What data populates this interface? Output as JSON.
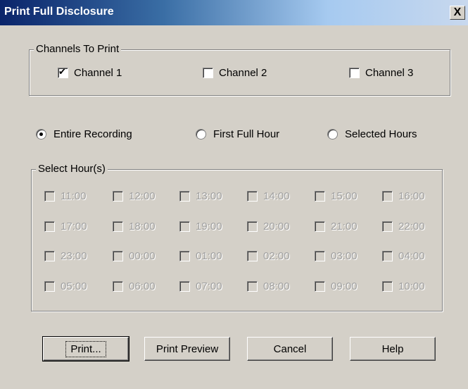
{
  "window": {
    "title": "Print Full Disclosure",
    "close_glyph": "X"
  },
  "channels": {
    "label": "Channels To Print",
    "items": [
      {
        "label": "Channel 1",
        "checked": true
      },
      {
        "label": "Channel 2",
        "checked": false
      },
      {
        "label": "Channel 3",
        "checked": false
      }
    ]
  },
  "range": {
    "options": [
      {
        "label": "Entire Recording",
        "selected": true
      },
      {
        "label": "First Full Hour",
        "selected": false
      },
      {
        "label": "Selected Hours",
        "selected": false
      }
    ]
  },
  "hours": {
    "label": "Select Hour(s)",
    "enabled": false,
    "items": [
      "11:00",
      "12:00",
      "13:00",
      "14:00",
      "15:00",
      "16:00",
      "17:00",
      "18:00",
      "19:00",
      "20:00",
      "21:00",
      "22:00",
      "23:00",
      "00:00",
      "01:00",
      "02:00",
      "03:00",
      "04:00",
      "05:00",
      "06:00",
      "07:00",
      "08:00",
      "09:00",
      "10:00"
    ]
  },
  "buttons": {
    "print": "Print...",
    "preview": "Print Preview",
    "cancel": "Cancel",
    "help": "Help"
  }
}
